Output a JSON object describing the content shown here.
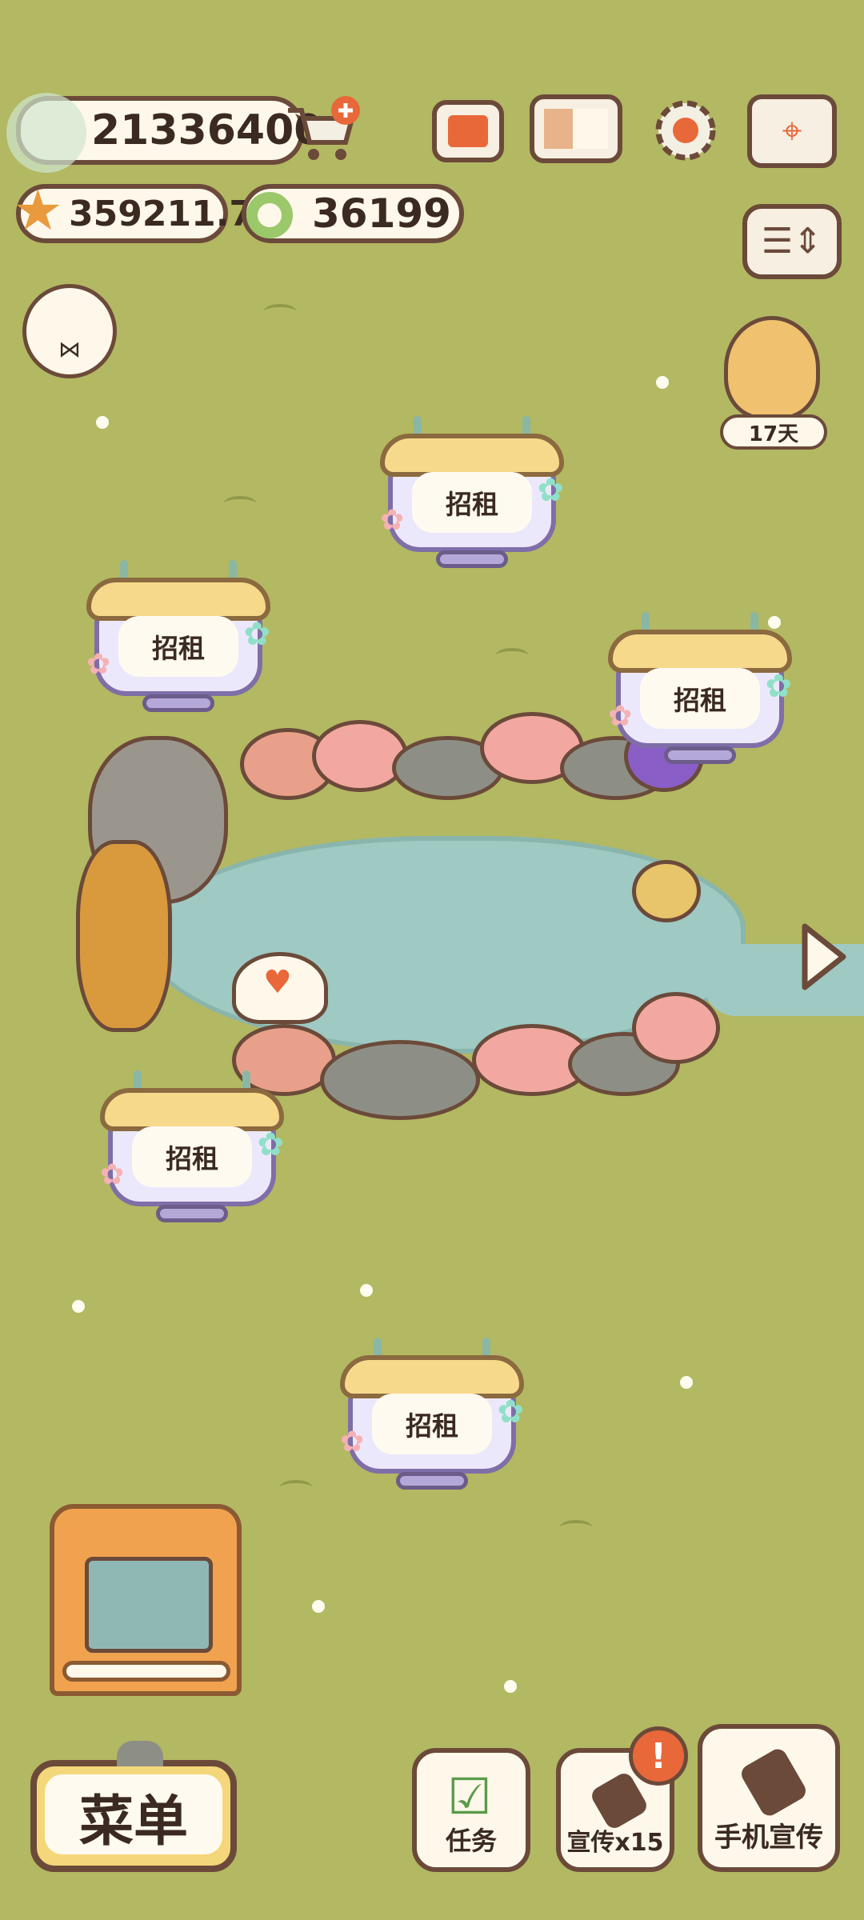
{
  "currencies": {
    "fish": "21336400",
    "star": "359211.7",
    "ring": "36199"
  },
  "event": {
    "days_left": "17天"
  },
  "signs": [
    "招租",
    "招租",
    "招租",
    "招租",
    "招租"
  ],
  "bottom": {
    "menu_label": "菜单",
    "tasks_label": "任务",
    "promo_label": "宣传x15",
    "phone_promo_label": "手机宣传",
    "alert_glyph": "!"
  },
  "icons": {
    "fish": "fish-icon",
    "cart": "cart-plus-icon",
    "star": "star-icon",
    "ring": "ring-coin-icon",
    "newspaper": "newspaper-icon",
    "book": "book-icon",
    "settings": "gear-icon",
    "map": "map-icon",
    "toggle": "layout-toggle-icon",
    "arrow": "arrow-right-icon"
  },
  "colors": {
    "grass": "#b3b862",
    "pond": "#9fc9c3",
    "accent": "#e8683a",
    "outline": "#6b4a3a"
  }
}
